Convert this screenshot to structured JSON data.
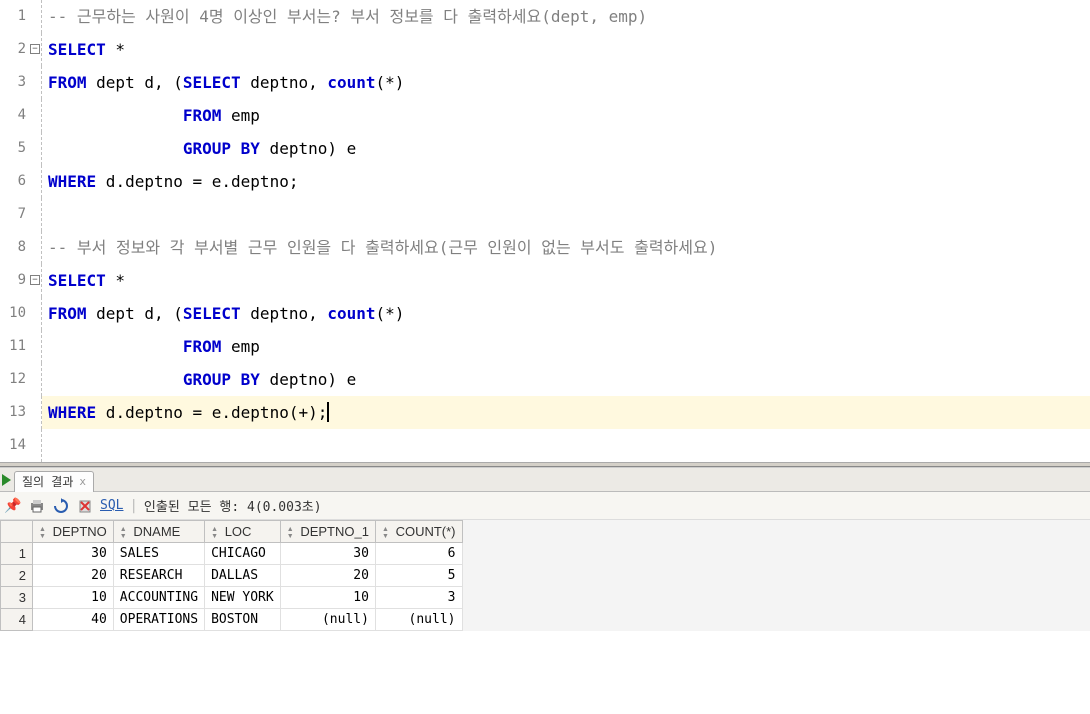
{
  "editor": {
    "lines": [
      {
        "num": "1",
        "fold": "none",
        "cls": "",
        "tokens": [
          {
            "t": "-- 근무하는 사원이 4명 이상인 부서는? 부서 정보를 다 출력하세요(dept, emp)",
            "c": "cm"
          }
        ]
      },
      {
        "num": "2",
        "fold": "box",
        "cls": "",
        "tokens": [
          {
            "t": "SELECT",
            "c": "kw"
          },
          {
            "t": " *",
            "c": "id"
          }
        ]
      },
      {
        "num": "3",
        "fold": "line",
        "cls": "",
        "tokens": [
          {
            "t": "FROM",
            "c": "kw"
          },
          {
            "t": " dept d, (",
            "c": "id"
          },
          {
            "t": "SELECT",
            "c": "kw"
          },
          {
            "t": " deptno, ",
            "c": "id"
          },
          {
            "t": "count",
            "c": "fn"
          },
          {
            "t": "(*)",
            "c": "id"
          }
        ]
      },
      {
        "num": "4",
        "fold": "line",
        "cls": "",
        "tokens": [
          {
            "t": "              ",
            "c": "id"
          },
          {
            "t": "FROM",
            "c": "kw"
          },
          {
            "t": " emp",
            "c": "id"
          }
        ]
      },
      {
        "num": "5",
        "fold": "line",
        "cls": "",
        "tokens": [
          {
            "t": "              ",
            "c": "id"
          },
          {
            "t": "GROUP BY",
            "c": "kw"
          },
          {
            "t": " deptno) e",
            "c": "id"
          }
        ]
      },
      {
        "num": "6",
        "fold": "line",
        "cls": "",
        "tokens": [
          {
            "t": "WHERE",
            "c": "kw"
          },
          {
            "t": " d.deptno = e.deptno;",
            "c": "id"
          }
        ]
      },
      {
        "num": "7",
        "fold": "none",
        "cls": "",
        "tokens": [
          {
            "t": "",
            "c": "id"
          }
        ]
      },
      {
        "num": "8",
        "fold": "none",
        "cls": "",
        "tokens": [
          {
            "t": "-- 부서 정보와 각 부서별 근무 인원을 다 출력하세요(근무 인원이 없는 부서도 출력하세요)",
            "c": "cm"
          }
        ]
      },
      {
        "num": "9",
        "fold": "box",
        "cls": "",
        "tokens": [
          {
            "t": "SELECT",
            "c": "kw"
          },
          {
            "t": " *",
            "c": "id"
          }
        ]
      },
      {
        "num": "10",
        "fold": "line",
        "cls": "",
        "tokens": [
          {
            "t": "FROM",
            "c": "kw"
          },
          {
            "t": " dept d, (",
            "c": "id"
          },
          {
            "t": "SELECT",
            "c": "kw"
          },
          {
            "t": " deptno, ",
            "c": "id"
          },
          {
            "t": "count",
            "c": "fn"
          },
          {
            "t": "(*)",
            "c": "id"
          }
        ]
      },
      {
        "num": "11",
        "fold": "line",
        "cls": "",
        "tokens": [
          {
            "t": "              ",
            "c": "id"
          },
          {
            "t": "FROM",
            "c": "kw"
          },
          {
            "t": " emp",
            "c": "id"
          }
        ]
      },
      {
        "num": "12",
        "fold": "line",
        "cls": "",
        "tokens": [
          {
            "t": "              ",
            "c": "id"
          },
          {
            "t": "GROUP BY",
            "c": "kw"
          },
          {
            "t": " deptno) e",
            "c": "id"
          }
        ]
      },
      {
        "num": "13",
        "fold": "line",
        "cls": "current-line",
        "tokens": [
          {
            "t": "WHERE",
            "c": "kw"
          },
          {
            "t": " d.deptno = e.deptno(+);",
            "c": "id"
          }
        ],
        "cursor": true
      },
      {
        "num": "14",
        "fold": "none",
        "cls": "",
        "tokens": [
          {
            "t": "",
            "c": "id"
          }
        ]
      }
    ]
  },
  "tab": {
    "label": "질의 결과",
    "close": "x"
  },
  "toolbar": {
    "sql_label": "SQL",
    "status": "인출된 모든 행: 4(0.003초)"
  },
  "table": {
    "columns": [
      "DEPTNO",
      "DNAME",
      "LOC",
      "DEPTNO_1",
      "COUNT(*)"
    ],
    "coltypes": [
      "num",
      "txt",
      "txt",
      "num",
      "num"
    ],
    "rows": [
      [
        "30",
        "SALES",
        "CHICAGO",
        "30",
        "6"
      ],
      [
        "20",
        "RESEARCH",
        "DALLAS",
        "20",
        "5"
      ],
      [
        "10",
        "ACCOUNTING",
        "NEW YORK",
        "10",
        "3"
      ],
      [
        "40",
        "OPERATIONS",
        "BOSTON",
        "(null)",
        "(null)"
      ]
    ]
  }
}
